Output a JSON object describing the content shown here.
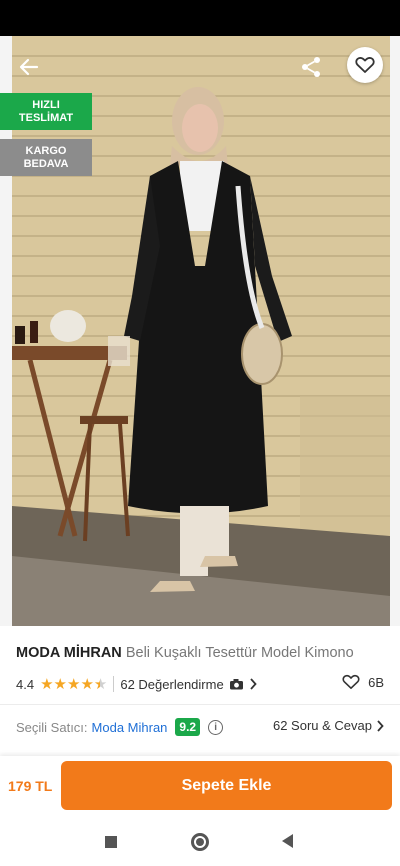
{
  "badges": {
    "fast": [
      "HIZLI",
      "TESLİMAT"
    ],
    "cargo": [
      "KARGO",
      "BEDAVA"
    ]
  },
  "carousel": {
    "count": 3,
    "active": 0
  },
  "product": {
    "brand": "MODA MİHRAN",
    "name": "Beli Kuşaklı Tesettür Model Kimono"
  },
  "rating": {
    "score": "4.4",
    "stars_value": 4.4,
    "reviews": "62 Değerlendirme",
    "likes": "6B"
  },
  "seller": {
    "label": "Seçili Satıcı:",
    "name": "Moda Mihran",
    "score": "9.2",
    "qa": "62 Soru & Cevap"
  },
  "cart": {
    "price": "179 TL",
    "button": "Sepete Ekle"
  },
  "colors": {
    "accent": "#f27a1a",
    "green": "#1ba84a",
    "link": "#1f6fd6"
  },
  "icons": [
    "back-arrow-icon",
    "share-icon",
    "heart-icon",
    "camera-icon",
    "chevron-right-icon",
    "info-icon"
  ]
}
